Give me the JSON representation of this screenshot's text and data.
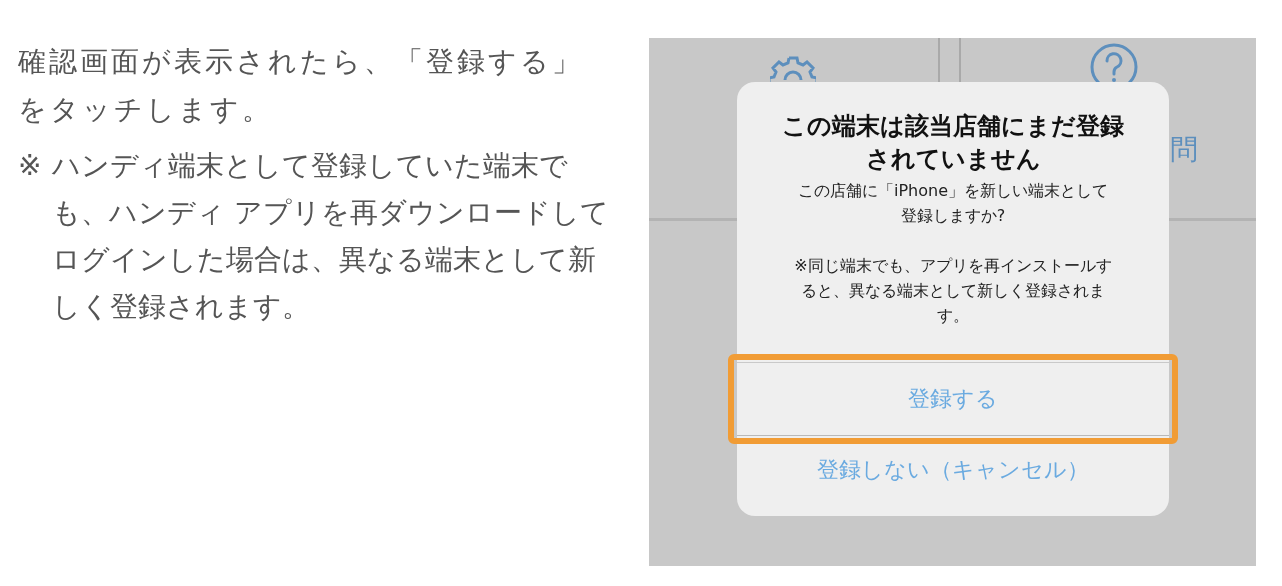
{
  "instruction": {
    "text": "確認画面が表示されたら、「登録する」をタッチします。",
    "note_mark": "※",
    "note": "ハンディ端末として登録していた端末でも、ハンディ アプリを再ダウンロードしてログインした場合は、異なる端末として新しく登録されます。"
  },
  "screenshot": {
    "background_label": "問",
    "dialog": {
      "title": "この端末は該当店舗にまだ登録されていません",
      "message": "この店舗に「iPhone」を新しい端末として登録しますか?",
      "note": "※同じ端末でも、アプリを再インストールすると、異なる端末として新しく登録されます。",
      "buttons": [
        {
          "label": "登録する",
          "highlighted": true
        },
        {
          "label": "登録しない（キャンセル）",
          "highlighted": false
        }
      ]
    }
  }
}
